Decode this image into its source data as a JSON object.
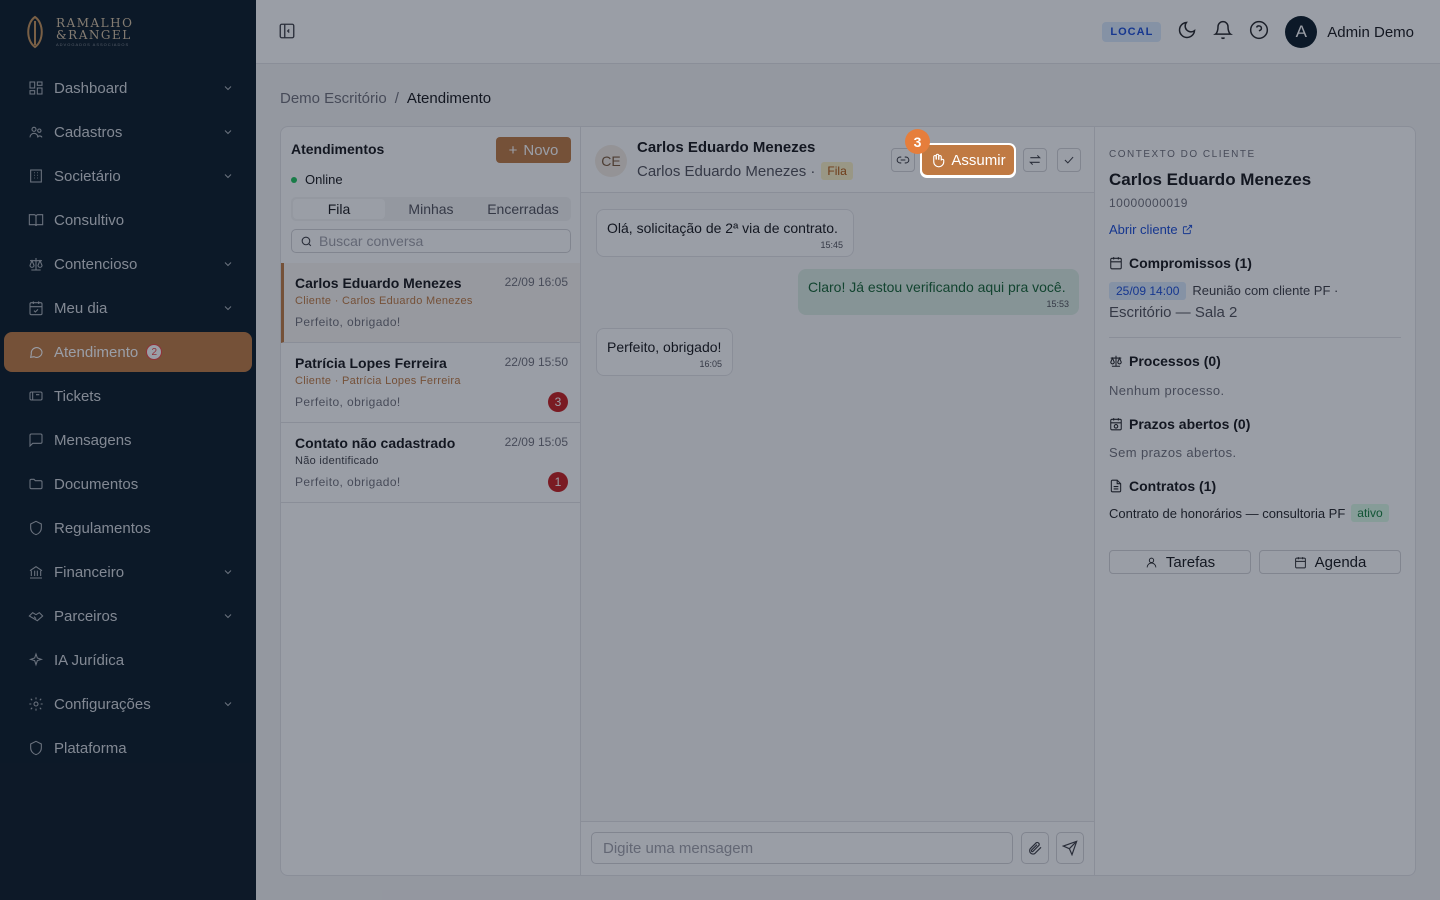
{
  "brand": {
    "line1": "RAMALHO",
    "line2": "&RANGEL",
    "line3": "ADVOGADOS ASSOCIADOS"
  },
  "sidebar": {
    "items": [
      {
        "label": "Dashboard",
        "icon": "dashboard-icon",
        "chevron": true
      },
      {
        "label": "Cadastros",
        "icon": "users-icon",
        "chevron": true
      },
      {
        "label": "Societário",
        "icon": "building-icon",
        "chevron": true
      },
      {
        "label": "Consultivo",
        "icon": "book-icon",
        "chevron": false
      },
      {
        "label": "Contencioso",
        "icon": "scale-icon",
        "chevron": true
      },
      {
        "label": "Meu dia",
        "icon": "calendar-icon",
        "chevron": true
      },
      {
        "label": "Atendimento",
        "icon": "chat-icon",
        "chevron": false,
        "badge": "2",
        "active": true
      },
      {
        "label": "Tickets",
        "icon": "ticket-icon",
        "chevron": false
      },
      {
        "label": "Mensagens",
        "icon": "message-icon",
        "chevron": false
      },
      {
        "label": "Documentos",
        "icon": "folder-icon",
        "chevron": false
      },
      {
        "label": "Regulamentos",
        "icon": "shield-icon",
        "chevron": false
      },
      {
        "label": "Financeiro",
        "icon": "bank-icon",
        "chevron": true
      },
      {
        "label": "Parceiros",
        "icon": "handshake-icon",
        "chevron": true
      },
      {
        "label": "IA Jurídica",
        "icon": "sparkles-icon",
        "chevron": false
      },
      {
        "label": "Configurações",
        "icon": "gear-icon",
        "chevron": true
      },
      {
        "label": "Plataforma",
        "icon": "shield-icon",
        "chevron": false
      }
    ]
  },
  "topbar": {
    "env": "LOCAL",
    "avatar_initial": "A",
    "user_name": "Admin Demo"
  },
  "breadcrumb": {
    "root": "Demo Escritório",
    "sep": "/",
    "current": "Atendimento"
  },
  "list": {
    "title": "Atendimentos",
    "new_label": "Novo",
    "status": "Online",
    "tabs": [
      "Fila",
      "Minhas",
      "Encerradas"
    ],
    "search_placeholder": "Buscar conversa",
    "conversations": [
      {
        "name": "Carlos Eduardo Menezes",
        "time": "22/09 16:05",
        "sub": "Cliente · Carlos Eduardo Menezes",
        "preview": "Perfeito, obrigado!",
        "unread": ""
      },
      {
        "name": "Patrícia Lopes Ferreira",
        "time": "22/09 15:50",
        "sub": "Cliente · Patrícia Lopes Ferreira",
        "preview": "Perfeito, obrigado!",
        "unread": "3"
      },
      {
        "name": "Contato não cadastrado",
        "time": "22/09 15:05",
        "sub": "Não identificado",
        "preview": "Perfeito, obrigado!",
        "unread": "1"
      }
    ]
  },
  "chat": {
    "initials": "CE",
    "name": "Carlos Eduardo Menezes",
    "sub": "Carlos Eduardo Menezes ·",
    "queue_tag": "Fila",
    "assume_label": "Assumir",
    "step": "3",
    "messages": [
      {
        "text": "Olá, solicitação de 2ª via de contrato.",
        "time": "15:45"
      },
      {
        "text": "Claro! Já estou verificando aqui pra você.",
        "time": "15:53"
      },
      {
        "text": "Perfeito, obrigado!",
        "time": "16:05"
      }
    ],
    "composer_placeholder": "Digite uma mensagem"
  },
  "context": {
    "label": "CONTEXTO DO CLIENTE",
    "name": "Carlos Eduardo Menezes",
    "id": "10000000019",
    "open_link": "Abrir cliente",
    "commitments_title": "Compromissos (1)",
    "appt_date": "25/09 14:00",
    "appt_title": "Reunião com cliente PF ·",
    "appt_location": "Escritório — Sala 2",
    "processes_title": "Processos (0)",
    "processes_empty": "Nenhum processo.",
    "deadlines_title": "Prazos abertos (0)",
    "deadlines_empty": "Sem prazos abertos.",
    "contracts_title": "Contratos (1)",
    "contract_name": "Contrato de honorários — consultoria PF",
    "contract_status": "ativo",
    "tasks_label": "Tarefas",
    "agenda_label": "Agenda"
  }
}
